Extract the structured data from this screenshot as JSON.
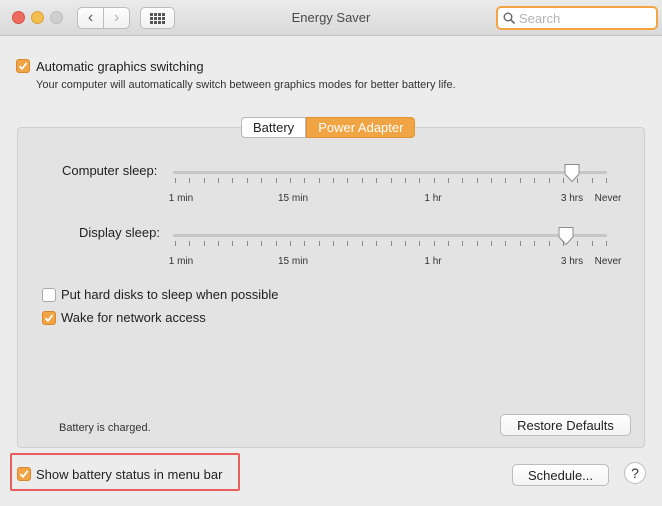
{
  "window": {
    "title": "Energy Saver",
    "back_glyph": "‹",
    "forward_glyph": "›"
  },
  "search": {
    "placeholder": "Search",
    "value": ""
  },
  "auto_graphics": {
    "label": "Automatic graphics switching",
    "checked": true,
    "description": "Your computer will automatically switch between graphics modes for better battery life."
  },
  "tabs": [
    {
      "label": "Battery",
      "selected": false
    },
    {
      "label": "Power Adapter",
      "selected": true
    }
  ],
  "computer_sleep": {
    "label": "Computer sleep:",
    "ticks": [
      "1 min",
      "15 min",
      "1 hr",
      "3 hrs",
      "Never"
    ],
    "value": "3 hrs"
  },
  "display_sleep": {
    "label": "Display sleep:",
    "ticks": [
      "1 min",
      "15 min",
      "1 hr",
      "3 hrs",
      "Never"
    ],
    "value": "3 hrs"
  },
  "hard_disks": {
    "label": "Put hard disks to sleep when possible",
    "checked": false
  },
  "wake_network": {
    "label": "Wake for network access",
    "checked": true
  },
  "battery_status_text": "Battery is charged.",
  "restore_defaults_label": "Restore Defaults",
  "show_battery": {
    "label": "Show battery status in menu bar",
    "checked": true
  },
  "schedule_label": "Schedule...",
  "help_label": "?",
  "colors": {
    "accent": "#f0a444",
    "highlight": "#ea5d5d"
  }
}
